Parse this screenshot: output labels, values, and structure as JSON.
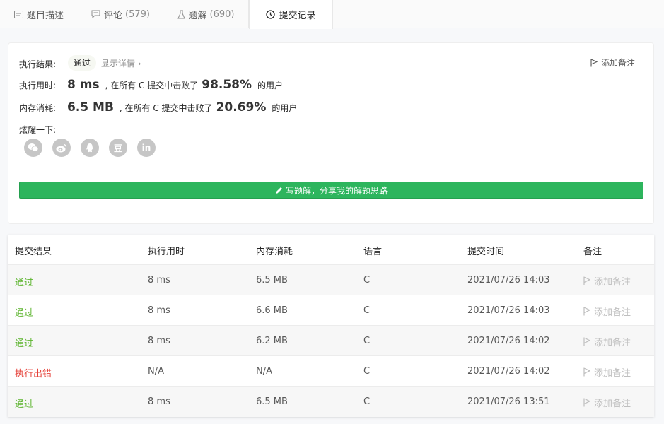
{
  "tabs": [
    {
      "label": "题目描述",
      "count": "",
      "icon": "description-icon"
    },
    {
      "label": "评论",
      "count": "(579)",
      "icon": "comment-icon"
    },
    {
      "label": "题解",
      "count": "(690)",
      "icon": "flask-icon"
    },
    {
      "label": "提交记录",
      "count": "",
      "icon": "clock-icon",
      "active": true
    }
  ],
  "result": {
    "label": "执行结果:",
    "status": "通过",
    "details_link": "显示详情 ›",
    "add_note": "添加备注",
    "runtime_label": "执行用时:",
    "runtime_value": "8 ms",
    "runtime_mid": ", 在所有 C 提交中击败了",
    "runtime_pct": "98.58%",
    "runtime_tail": "的用户",
    "memory_label": "内存消耗:",
    "memory_value": "6.5 MB",
    "memory_mid": ", 在所有 C 提交中击败了",
    "memory_pct": "20.69%",
    "memory_tail": "的用户",
    "share_label": "炫耀一下:",
    "share_buttons": [
      {
        "name": "wechat-icon",
        "glyph": ""
      },
      {
        "name": "weibo-icon",
        "glyph": ""
      },
      {
        "name": "qq-icon",
        "glyph": ""
      },
      {
        "name": "douban-icon",
        "glyph": "豆"
      },
      {
        "name": "linkedin-icon",
        "glyph": "in"
      }
    ],
    "write_button": "写题解，分享我的解题思路"
  },
  "table": {
    "headers": [
      "提交结果",
      "执行用时",
      "内存消耗",
      "语言",
      "提交时间",
      "备注"
    ],
    "rows": [
      {
        "status": "通过",
        "ok": true,
        "runtime": "8 ms",
        "memory": "6.5 MB",
        "lang": "C",
        "time": "2021/07/26 14:03",
        "note": "添加备注"
      },
      {
        "status": "通过",
        "ok": true,
        "runtime": "8 ms",
        "memory": "6.6 MB",
        "lang": "C",
        "time": "2021/07/26 14:03",
        "note": "添加备注"
      },
      {
        "status": "通过",
        "ok": true,
        "runtime": "8 ms",
        "memory": "6.2 MB",
        "lang": "C",
        "time": "2021/07/26 14:02",
        "note": "添加备注"
      },
      {
        "status": "执行出错",
        "ok": false,
        "runtime": "N/A",
        "memory": "N/A",
        "lang": "C",
        "time": "2021/07/26 14:02",
        "note": "添加备注"
      },
      {
        "status": "通过",
        "ok": true,
        "runtime": "8 ms",
        "memory": "6.5 MB",
        "lang": "C",
        "time": "2021/07/26 13:51",
        "note": "添加备注"
      }
    ]
  },
  "colors": {
    "accent_green": "#2db55d",
    "status_ok": "#5eb530",
    "status_error": "#e5423a"
  }
}
